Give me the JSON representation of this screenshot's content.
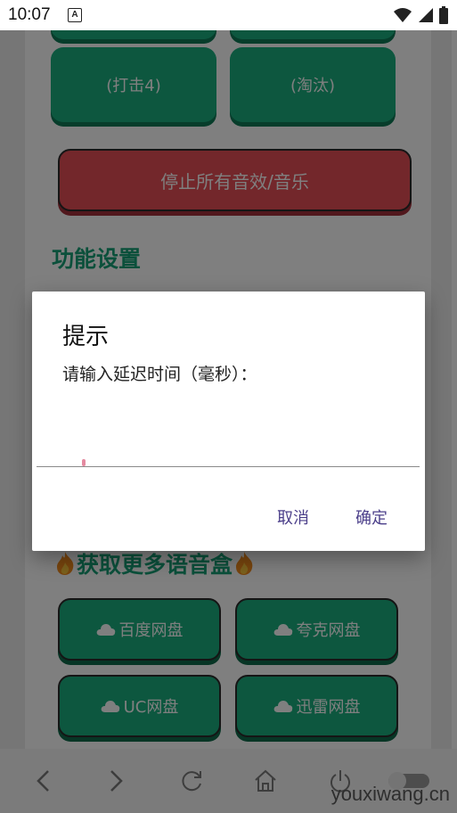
{
  "status_bar": {
    "time": "10:07",
    "notification_icon": "A"
  },
  "buttons": {
    "hit4": "(打击4)",
    "eliminate": "(淘汰)",
    "stop_all": "停止所有音效/音乐"
  },
  "section_function": "功能设置",
  "section_more": "获取更多语音盒",
  "downloads": {
    "baidu": "百度网盘",
    "quark": "夸克网盘",
    "uc": "UC网盘",
    "xunlei": "迅雷网盘"
  },
  "dialog": {
    "title": "提示",
    "message": "请输入延迟时间（毫秒）：",
    "input_value": "",
    "cancel": "取消",
    "confirm": "确定"
  },
  "watermark": "youxiwang.cn",
  "icons": [
    "alert-a-icon",
    "wifi-icon",
    "signal-icon",
    "battery-icon",
    "cloud-icon",
    "fire-icon",
    "back-icon",
    "forward-icon",
    "refresh-icon",
    "home-icon",
    "power-icon",
    "toggle-icon"
  ],
  "colors": {
    "green": "#1aae7f",
    "red": "#e64e56",
    "section": "#16a076",
    "dialog_action": "#4b3f8a"
  }
}
